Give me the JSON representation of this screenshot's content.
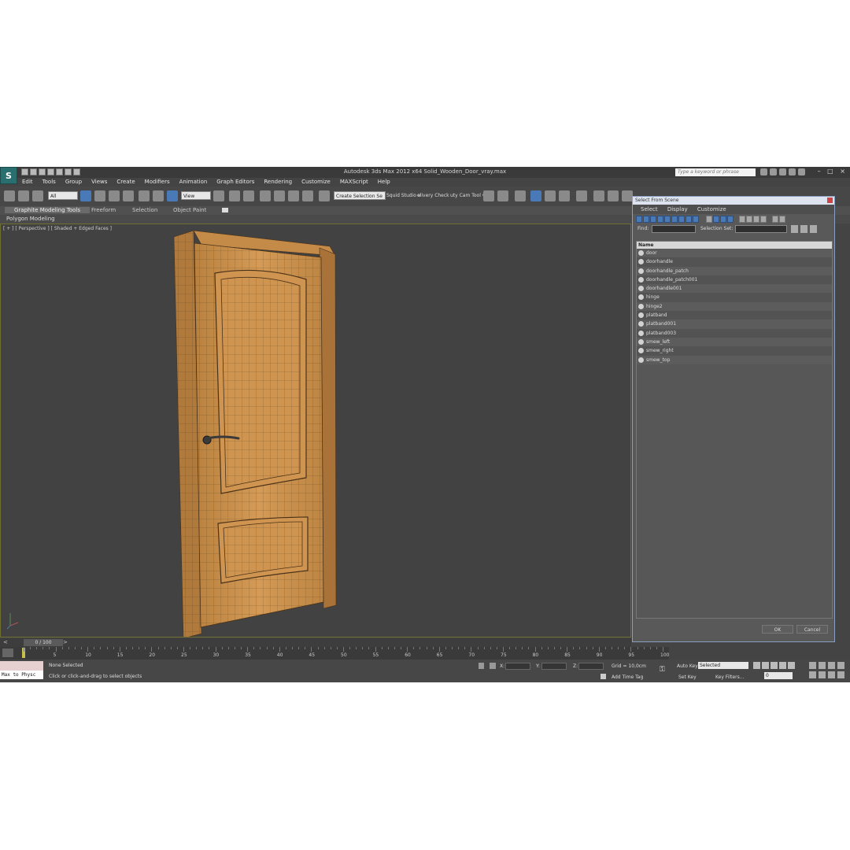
{
  "window": {
    "title": "Autodesk 3ds Max  2012 x64     Solid_Wooden_Door_vray.max",
    "search_placeholder": "Type a keyword or phrase",
    "controls": "– □ ×"
  },
  "app": {
    "logo": "S"
  },
  "menu": [
    "Edit",
    "Tools",
    "Group",
    "Views",
    "Create",
    "Modifiers",
    "Animation",
    "Graph Editors",
    "Rendering",
    "Customize",
    "MAXScript",
    "Help"
  ],
  "toolbar": {
    "filter_value": "All",
    "refcoord_value": "View",
    "selection_set_value": "Create Selection Se",
    "plugin1": "Squid Studio v",
    "plugin2": "elivery Check",
    "plugin3": "uty Cam Tool v"
  },
  "ribbon": {
    "tabs": [
      "Graphite Modeling Tools",
      "Freeform",
      "Selection",
      "Object Paint"
    ],
    "panel": "Polygon Modeling"
  },
  "viewport": {
    "label": "[ + ] [ Perspective ] [ Shaded + Edged Faces ]"
  },
  "dialog": {
    "title": "Select From Scene",
    "menu": [
      "Select",
      "Display",
      "Customize"
    ],
    "find_label": "Find:",
    "selection_set_label": "Selection Set:",
    "column_header": "Name",
    "items": [
      "door",
      "doorhandle",
      "doorhandle_patch",
      "doorhandle_patch001",
      "doorhandle001",
      "hinge",
      "hinge2",
      "platband",
      "platband001",
      "platband003",
      "smew_left",
      "smew_right",
      "smew_top"
    ],
    "ok_label": "OK",
    "cancel_label": "Cancel"
  },
  "timeline": {
    "frame_display": "0 / 100",
    "ticks": [
      "5",
      "10",
      "15",
      "20",
      "25",
      "30",
      "35",
      "40",
      "45",
      "50",
      "55",
      "60",
      "65",
      "70",
      "75",
      "80",
      "85",
      "90",
      "95",
      "100"
    ]
  },
  "status": {
    "maxscript_text": "Max to Physc",
    "selection_text": "None Selected",
    "prompt_text": "Click or click-and-drag to select objects",
    "x_label": "X:",
    "y_label": "Y:",
    "z_label": "Z:",
    "grid_text": "Grid = 10,0cm",
    "add_time_tag": "Add Time Tag",
    "auto_key": "Auto Key",
    "set_key": "Set Key",
    "key_mode_value": "Selected",
    "key_filters": "Key Filters...",
    "frame_value": "0"
  },
  "colors": {
    "accent": "#4a79b8",
    "viewport_bg": "#424242",
    "wood": "#c98f4c"
  }
}
